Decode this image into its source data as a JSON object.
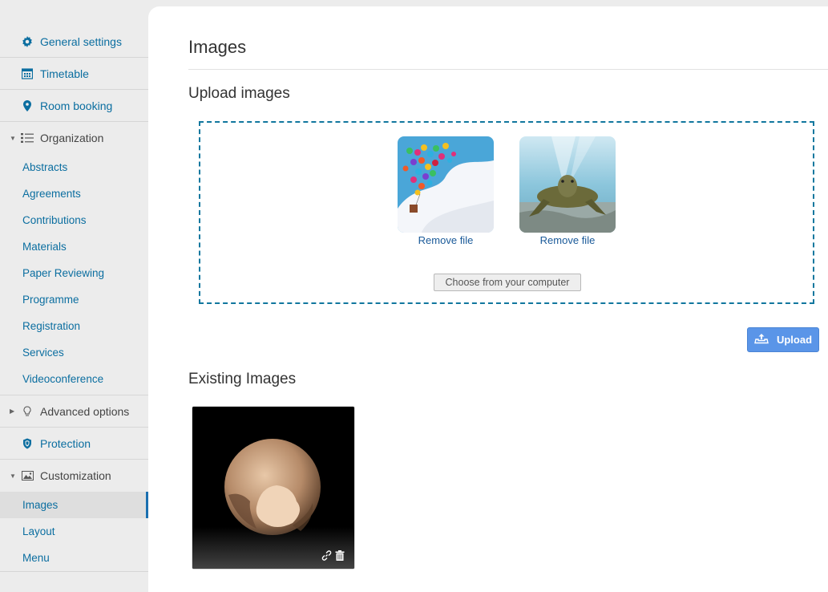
{
  "sidebar": {
    "top_items": [
      {
        "label": "General settings",
        "icon": "gear-icon"
      },
      {
        "label": "Timetable",
        "icon": "calendar-icon"
      },
      {
        "label": "Room booking",
        "icon": "map-pin-icon"
      }
    ],
    "organization": {
      "label": "Organization",
      "icon": "list-icon",
      "items": [
        "Abstracts",
        "Agreements",
        "Contributions",
        "Materials",
        "Paper Reviewing",
        "Programme",
        "Registration",
        "Services",
        "Videoconference"
      ]
    },
    "advanced": {
      "label": "Advanced options",
      "icon": "lightbulb-icon"
    },
    "protection": {
      "label": "Protection",
      "icon": "shield-icon"
    },
    "customization": {
      "label": "Customization",
      "icon": "image-icon",
      "items": [
        "Images",
        "Layout",
        "Menu"
      ],
      "active": "Images"
    }
  },
  "main": {
    "title": "Images",
    "upload_section_title": "Upload images",
    "dropzone": {
      "files": [
        {
          "name": "balloons",
          "remove_label": "Remove file"
        },
        {
          "name": "turtle",
          "remove_label": "Remove file"
        }
      ],
      "choose_label": "Choose from your computer"
    },
    "upload_button_label": "Upload",
    "existing_section_title": "Existing Images",
    "existing_images": [
      {
        "name": "pluto",
        "actions": [
          "link-icon",
          "trash-icon"
        ]
      }
    ]
  },
  "colors": {
    "link": "#0b6ea0",
    "accent": "#5a95e8",
    "dropzone_border": "#11779e",
    "active_marker": "#1a6fb0"
  }
}
